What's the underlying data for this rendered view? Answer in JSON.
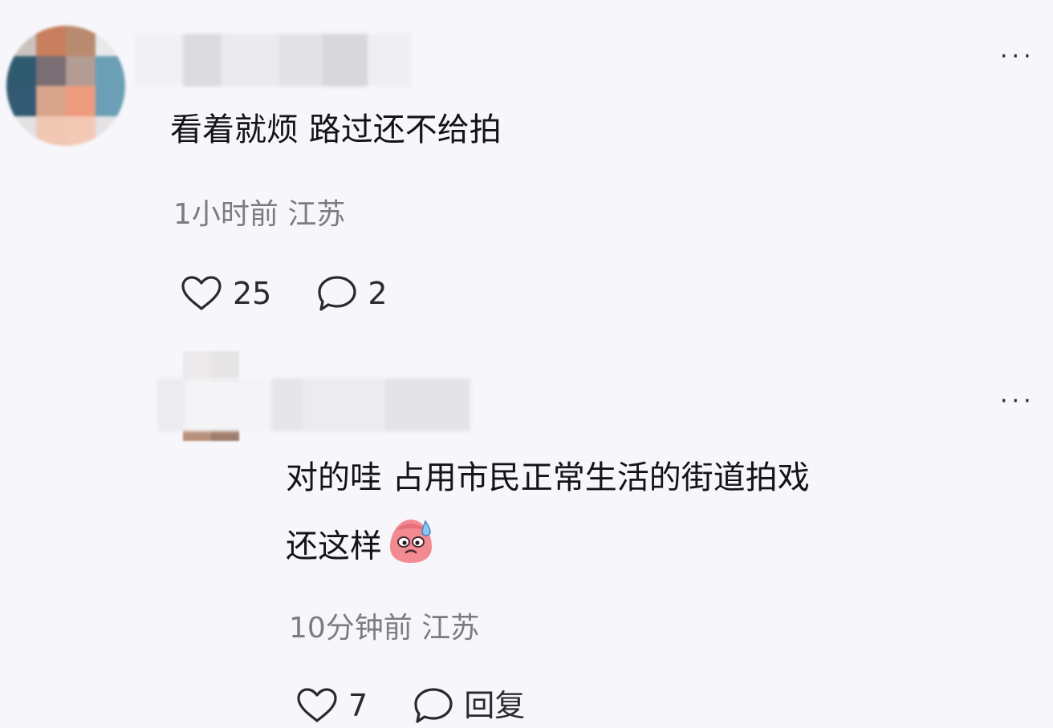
{
  "comments": [
    {
      "text": "看着就烦 路过还不给拍",
      "meta": "1小时前 江苏",
      "likes": "25",
      "replies": "2"
    },
    {
      "text_line1": "对的哇 占用市民正常生活的街道拍戏",
      "text_line2": "还这样",
      "emoji_icon": "sweating-face-emoji",
      "meta": "10分钟前 江苏",
      "likes": "7",
      "reply_label": "回复"
    }
  ],
  "more_label": "···",
  "colors": {
    "background": "#f7f7fb",
    "text": "#141418",
    "meta": "#7b7b82"
  }
}
